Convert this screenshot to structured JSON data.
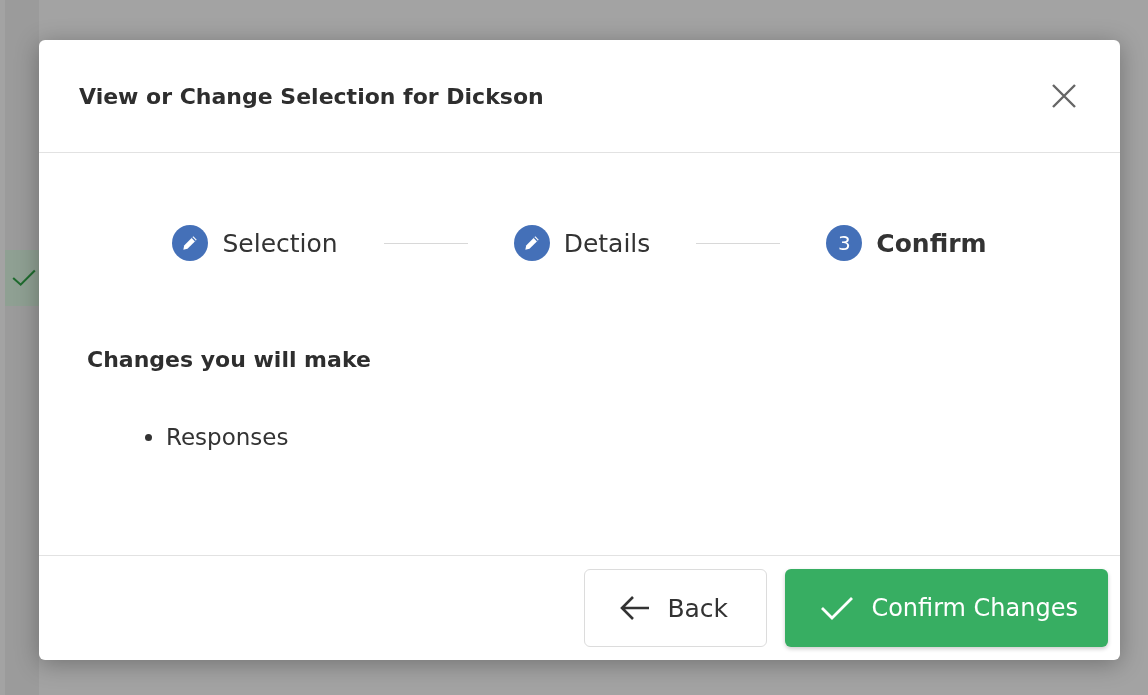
{
  "dialog": {
    "title": "View or Change Selection for Dickson"
  },
  "steps": [
    {
      "label": "Selection",
      "completed": true,
      "selected": false
    },
    {
      "label": "Details",
      "completed": true,
      "selected": false
    },
    {
      "label": "Confirm",
      "number": "3",
      "completed": false,
      "selected": true
    }
  ],
  "summary": {
    "heading": "Changes you will make",
    "items": [
      "Responses"
    ]
  },
  "buttons": [
    {
      "kind": "back",
      "label": "Back"
    },
    {
      "kind": "confirm",
      "label": "Confirm Changes"
    }
  ]
}
